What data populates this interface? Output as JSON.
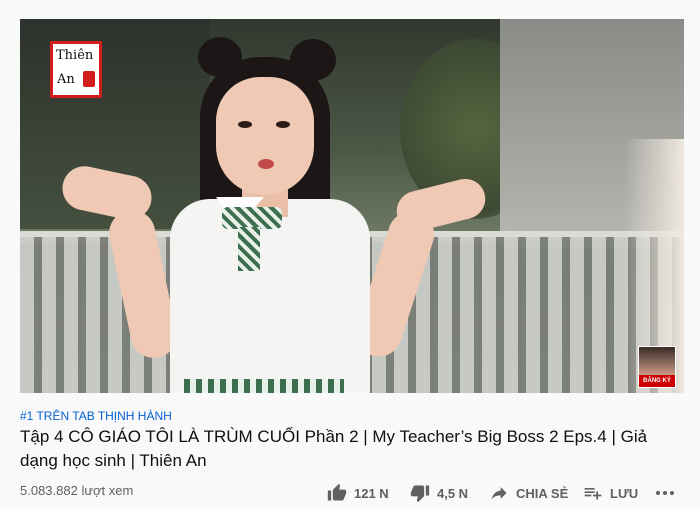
{
  "video": {
    "channel_logo_line1": "Thiên",
    "channel_logo_line2": "An",
    "watermark_subscribe": "ĐĂNG KÝ"
  },
  "trending_badge": "#1 TRÊN TAB THỊNH HÀNH",
  "title": "Tập 4 CÔ GIÁO TÔI LÀ TRÙM CUỐI Phần 2 | My Teacher’s Big Boss 2 Eps.4 | Giả dạng học sinh | Thiên An",
  "views": "5.083.882 lượt xem",
  "actions": {
    "like_count": "121 N",
    "dislike_count": "4,5 N",
    "share_label": "CHIA SẺ",
    "save_label": "LƯU"
  },
  "icons": {
    "like": "thumb-up-icon",
    "dislike": "thumb-down-icon",
    "share": "share-arrow-icon",
    "save": "playlist-add-icon",
    "more": "more-horizontal-icon"
  },
  "colors": {
    "link": "#065fd4",
    "secondary_text": "#606060",
    "logo_red": "#d21d1d"
  }
}
